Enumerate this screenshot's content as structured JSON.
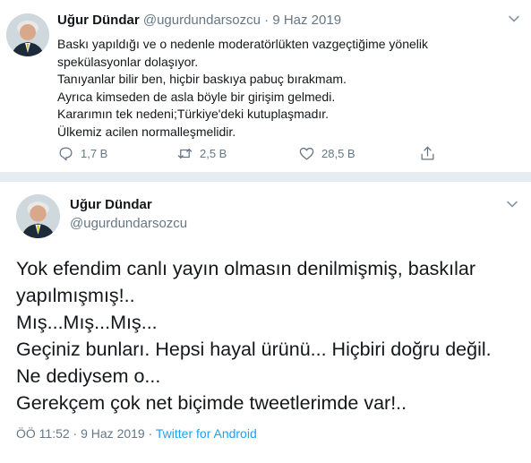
{
  "tweet1": {
    "author_name": "Uğur Dündar",
    "handle": "@ugurdundarsozcu",
    "separator": " · ",
    "date": "9 Haz 2019",
    "lines": [
      "Baskı yapıldığı ve o nedenle moderatörlükten vazgeçtiğime yönelik",
      "spekülasyonlar dolaşıyor.",
      "Tanıyanlar bilir ben, hiçbir baskıya pabuç bırakmam.",
      "Ayrıca kimseden de asla böyle bir girişim gelmedi.",
      "Kararımın tek nedeni;Türkiye'deki kutuplaşmadır.",
      "Ülkemiz acilen normalleşmelidir."
    ],
    "actions": {
      "reply_icon": "reply-icon",
      "reply_count": "1,7 B",
      "retweet_icon": "retweet-icon",
      "retweet_count": "2,5 B",
      "like_icon": "heart-icon",
      "like_count": "28,5 B",
      "share_icon": "share-icon"
    }
  },
  "tweet2": {
    "author_name": "Uğur Dündar",
    "handle": "@ugurdundarsozcu",
    "lines": [
      "Yok efendim canlı yayın olmasın denilmişmiş, baskılar",
      "yapılmışmış!..",
      "Mış...Mış...Mış...",
      "Geçiniz bunları. Hepsi hayal ürünü... Hiçbiri doğru değil.",
      "Ne dediysem o...",
      "Gerekçem çok net biçimde tweetlerimde var!.."
    ],
    "timestamp": "ÖÖ 11:52 · 9 Haz 2019 · ",
    "source": "Twitter for Android"
  },
  "colors": {
    "background": "#e6ecf0",
    "link": "#1da1f2",
    "muted": "#657786"
  }
}
